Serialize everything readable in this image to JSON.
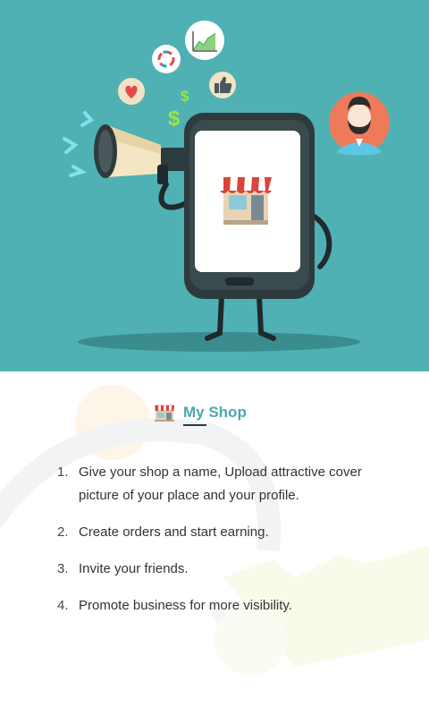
{
  "hero": {
    "illustration": "phone-with-megaphone-and-shop",
    "icons": [
      "megaphone-icon",
      "heart-icon",
      "cycle-icon",
      "chart-icon",
      "thumbs-up-icon",
      "dollar-icon",
      "store-icon",
      "user-avatar"
    ]
  },
  "section": {
    "icon": "store-icon",
    "title": "My Shop"
  },
  "steps": [
    {
      "num": "1.",
      "text": "Give your shop a name, Upload attractive cover picture of your place and your profile."
    },
    {
      "num": "2.",
      "text": "Create orders and start earning."
    },
    {
      "num": "3.",
      "text": "Invite your friends."
    },
    {
      "num": "4.",
      "text": "Promote business for more visibility."
    }
  ],
  "colors": {
    "hero_bg": "#4fb1b3",
    "accent": "#4aa8ad",
    "text": "#333333"
  }
}
